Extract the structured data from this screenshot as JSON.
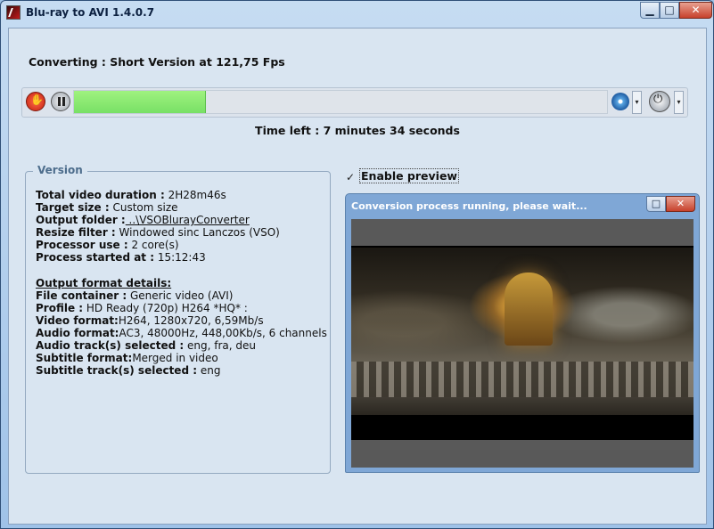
{
  "window": {
    "title": "Blu-ray to AVI 1.4.0.7",
    "minimize_glyph": "▁",
    "maximize_glyph": "□",
    "close_glyph": "✕"
  },
  "status": {
    "converting_text": "Converting :  Short Version  at  121,75 Fps",
    "progress_fraction": 0.248,
    "time_left_text": "Time left :  7 minutes 34 seconds"
  },
  "toolbar": {
    "icons": [
      "stop-hand-icon",
      "pause-icon",
      "disc-icon",
      "chevron-down-icon",
      "power-icon",
      "chevron-down-icon"
    ],
    "dropdown_glyph": "▾"
  },
  "version_group": {
    "title": "Version",
    "rows": [
      {
        "label": "Total video duration :",
        "value": " 2H28m46s"
      },
      {
        "label": "Target size :",
        "value": " Custom size"
      },
      {
        "label": "Output folder :",
        "value": " ..\\VSOBlurayConverter"
      },
      {
        "label": "Resize filter :",
        "value": " Windowed sinc Lanczos (VSO)"
      },
      {
        "label": "Processor use :",
        "value": " 2 core(s)"
      },
      {
        "label": "Process started at :",
        "value": " 15:12:43"
      }
    ],
    "details_header": "Output format details:",
    "details": [
      {
        "label": "File container :",
        "value": " Generic video (AVI)"
      },
      {
        "label": "Profile :",
        "value": " HD Ready (720p) H264 *HQ* :"
      },
      {
        "label": "Video format:",
        "value": "H264, 1280x720, 6,59Mb/s"
      },
      {
        "label": "Audio format:",
        "value": "AC3, 48000Hz, 448,00Kb/s, 6 channels"
      },
      {
        "label": "Audio track(s) selected :",
        "value": "  eng, fra, deu"
      },
      {
        "label": "Subtitle format:",
        "value": "Merged in video"
      },
      {
        "label": "Subtitle track(s) selected :",
        "value": "  eng"
      }
    ]
  },
  "preview": {
    "checkbox_label": "Enable preview",
    "checked": true,
    "check_glyph": "✓",
    "window_title": "Conversion process running, please wait...",
    "maximize_glyph": "□",
    "close_glyph": "✕"
  }
}
